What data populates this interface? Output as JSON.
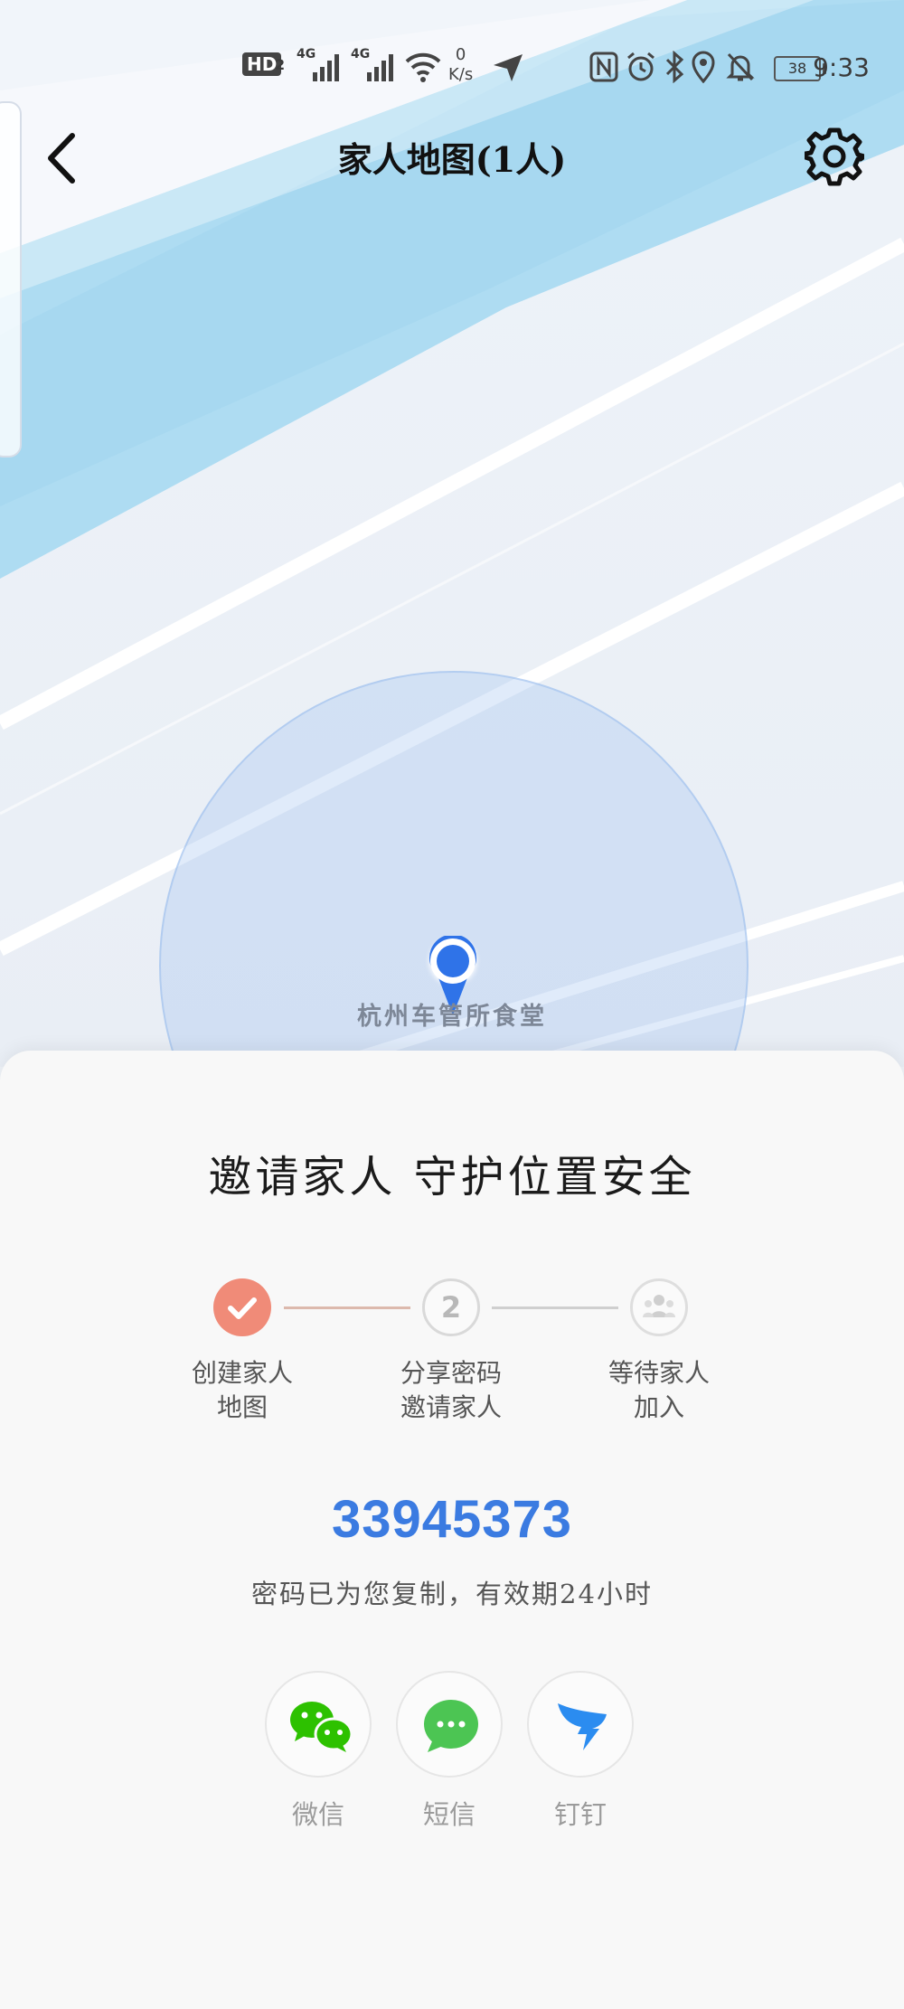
{
  "status_bar": {
    "hd_label": "HD",
    "hd_sub": "2",
    "net1": "4G",
    "net2": "4G",
    "speed_value": "0",
    "speed_unit": "K/s",
    "battery": "38",
    "time": "9:33"
  },
  "header": {
    "title": "家人地图(1人)"
  },
  "map": {
    "place_label": "杭州车管所食堂"
  },
  "invite": {
    "title": "邀请家人 守护位置安全",
    "steps": [
      {
        "line1": "创建家人",
        "line2": "地图",
        "state": "done"
      },
      {
        "number": "2",
        "line1": "分享密码",
        "line2": "邀请家人",
        "state": "current"
      },
      {
        "line1": "等待家人",
        "line2": "加入",
        "state": "pending"
      }
    ],
    "code": "33945373",
    "code_note": "密码已为您复制，有效期24小时",
    "share": [
      {
        "label": "微信",
        "icon": "wechat-icon",
        "color": "#2dc100"
      },
      {
        "label": "短信",
        "icon": "sms-icon",
        "color": "#4cc553"
      },
      {
        "label": "钉钉",
        "icon": "dingtalk-icon",
        "color": "#2b8cf0"
      }
    ]
  },
  "colors": {
    "accent_blue": "#3b7be1",
    "step_done": "#f08b78",
    "pin_blue": "#2f73e8"
  }
}
